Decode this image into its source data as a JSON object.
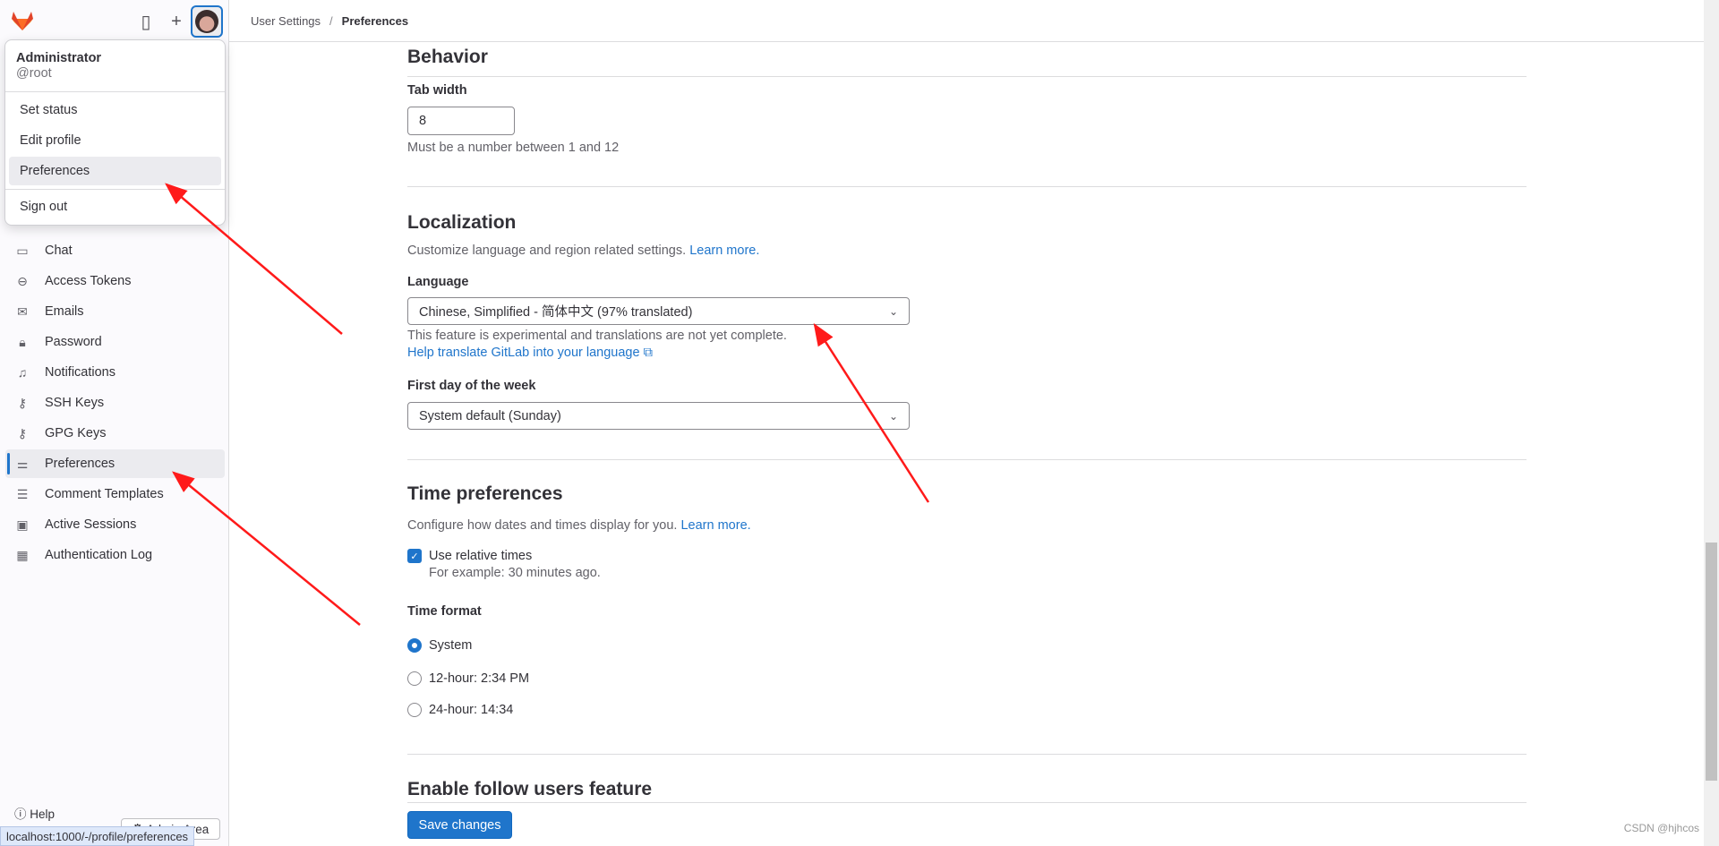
{
  "header": {
    "breadcrumb": [
      "User Settings",
      "Preferences"
    ]
  },
  "user_menu": {
    "name": "Administrator",
    "handle": "@root",
    "items": [
      "Set status",
      "Edit profile",
      "Preferences",
      "Sign out"
    ]
  },
  "sidebar": {
    "items": [
      {
        "label": "Chat",
        "icon": "comment-icon"
      },
      {
        "label": "Access Tokens",
        "icon": "token-icon"
      },
      {
        "label": "Emails",
        "icon": "mail-icon"
      },
      {
        "label": "Password",
        "icon": "lock-icon"
      },
      {
        "label": "Notifications",
        "icon": "bell-icon"
      },
      {
        "label": "SSH Keys",
        "icon": "key-icon"
      },
      {
        "label": "GPG Keys",
        "icon": "key-icon"
      },
      {
        "label": "Preferences",
        "icon": "preferences-icon",
        "active": true
      },
      {
        "label": "Comment Templates",
        "icon": "comment-lines-icon"
      },
      {
        "label": "Active Sessions",
        "icon": "monitor-icon"
      },
      {
        "label": "Authentication Log",
        "icon": "log-icon"
      }
    ],
    "help": "Help",
    "admin_area": "Admin Area"
  },
  "behavior": {
    "title": "Behavior",
    "tab_width_label": "Tab width",
    "tab_width_value": "8",
    "tab_width_help": "Must be a number between 1 and 12"
  },
  "localization": {
    "title": "Localization",
    "description": "Customize language and region related settings.",
    "learn_more": "Learn more.",
    "language_label": "Language",
    "language_value": "Chinese, Simplified - 简体中文 (97% translated)",
    "language_note": "This feature is experimental and translations are not yet complete.",
    "help_translate": "Help translate GitLab into your language",
    "first_day_label": "First day of the week",
    "first_day_value": "System default (Sunday)"
  },
  "time": {
    "title": "Time preferences",
    "description": "Configure how dates and times display for you.",
    "learn_more": "Learn more.",
    "relative_label": "Use relative times",
    "relative_checked": true,
    "relative_help": "For example: 30 minutes ago.",
    "format_label": "Time format",
    "formats": [
      "System",
      "12-hour: 2:34 PM",
      "24-hour: 14:34"
    ],
    "selected_format": "System"
  },
  "follow": {
    "title": "Enable follow users feature"
  },
  "save_label": "Save changes",
  "status_url": "localhost:1000/-/profile/preferences",
  "watermark": "CSDN @hjhcos",
  "colors": {
    "accent": "#1f75cb",
    "annotation": "#ff1a1a"
  }
}
